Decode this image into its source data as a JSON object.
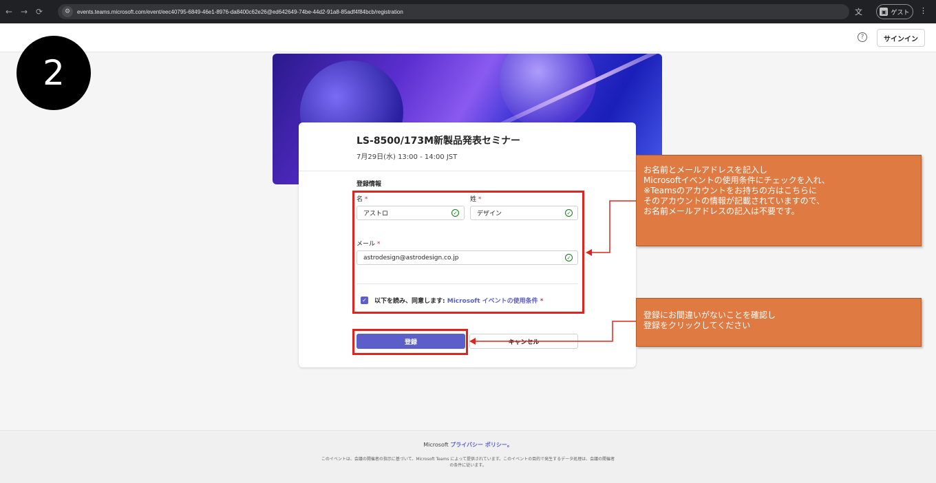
{
  "browser": {
    "url": "events.teams.microsoft.com/event/eec40795-6849-46e1-8976-da8400c62e26@ed642649-74be-44d2-91a8-85adf4f84bcb/registration",
    "guest_label": "ゲスト"
  },
  "header": {
    "signin_label": "サインイン"
  },
  "step_number": "2",
  "event": {
    "title": "LS-8500/173M新製品発表セミナー",
    "date": "7月29日(水) 13:00 - 14:00 JST"
  },
  "form": {
    "section_title": "登録情報",
    "first_name_label": "名",
    "first_name_value": "アストロ",
    "last_name_label": "姓",
    "last_name_value": "デザイン",
    "email_label": "メール",
    "email_value": "astrodesign@astrodesign.co.jp",
    "required_mark": "*",
    "agree_text": "以下を読み、同意します: ",
    "agree_link": "Microsoft イベントの使用条件",
    "register_label": "登録",
    "cancel_label": "キャンセル"
  },
  "callouts": {
    "first": [
      "お名前とメールアドレスを記入し",
      "Microsoftイベントの使用条件にチェックを入れ、",
      "※Teamsのアカウントをお持ちの方はこちらに",
      "そのアカウントの情報が記載されていますので、",
      "お名前メールアドレスの記入は不要です。"
    ],
    "second": [
      "登録にお間違いがないことを確認し",
      "登録をクリックしてください"
    ]
  },
  "footer": {
    "policy_prefix": "Microsoft ",
    "policy_link": "プライバシー ポリシー。",
    "note": "このイベントは、会議の開催者の指示に基づいて、Microsoft Teams によって提供されています。このイベントの目的で発生するデータ処理は、会議の開催者の条件に従います。"
  },
  "colors": {
    "brand": "#5b5fc7",
    "highlight": "#e0231c",
    "callout": "#de7a42",
    "success": "#107c10"
  }
}
